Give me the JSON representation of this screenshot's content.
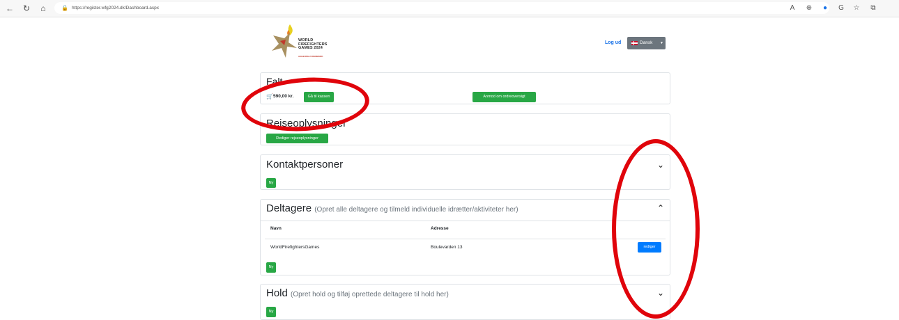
{
  "browser": {
    "url": "https://register.wfg2024.dk/Dashboard.aspx",
    "back_icon": "arrow-left-icon",
    "reload_icon": "reload-icon",
    "home_icon": "home-icon",
    "lock_icon": "lock-icon"
  },
  "header": {
    "logo_lines": [
      "WORLD",
      "FIREFIGHTERS",
      "GAMES 2024"
    ],
    "logo_sub": "AALBORG 23 DENMARK",
    "logout": "Log ud",
    "language": "Dansk"
  },
  "cart": {
    "title": "Falt",
    "amount": "590,00 kr.",
    "checkout": "Gå til kassen",
    "request_overview": "Anmod om ordreoversigt"
  },
  "travel": {
    "title": "Rejseoplysninger",
    "edit": "Rediger rejseoplysninger"
  },
  "contacts": {
    "title": "Kontaktpersoner",
    "new": "Ny"
  },
  "participants": {
    "title": "Deltagere",
    "subtitle": "(Opret alle deltagere og tilmeld individuelle idrætter/aktiviteter her)",
    "columns": [
      "Navn",
      "Adresse"
    ],
    "rows": [
      {
        "name": "WorldFirefightersGames",
        "address": "Boulevarden 13",
        "action": "rediger"
      }
    ],
    "new": "Ny"
  },
  "teams": {
    "title": "Hold",
    "subtitle": "(Opret hold og tilføj oprettede deltagere til hold her)",
    "new": "Ny"
  },
  "colors": {
    "green": "#28a745",
    "blue": "#007bff",
    "annotation_red": "#e0040b"
  }
}
